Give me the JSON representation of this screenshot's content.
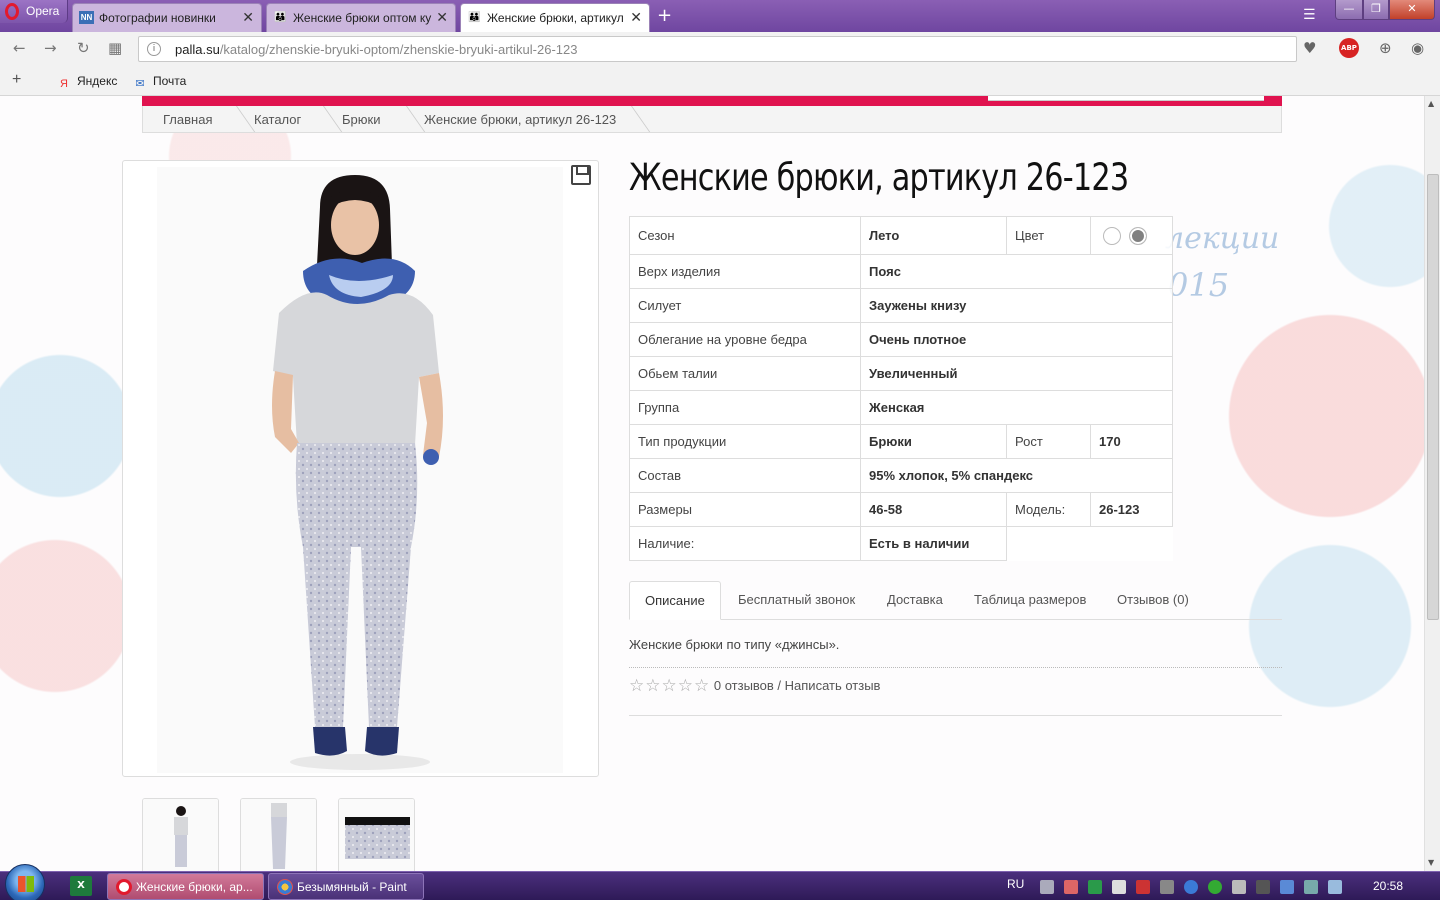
{
  "browser": {
    "menu_label": "Opera",
    "tabs": [
      {
        "favicon": "NN",
        "label": "Фотографии новинки",
        "active": false
      },
      {
        "favicon": "people-icon",
        "label": "Женские брюки оптом ку",
        "active": false
      },
      {
        "favicon": "people-icon",
        "label": "Женские брюки, артикул",
        "active": true
      }
    ],
    "url_host": "palla.su",
    "url_path": "/katalog/zhenskie-bryuki-optom/zhenskie-bryuki-artikul-26-123",
    "abp_label": "ABP",
    "bookmarks": [
      {
        "label": "Яндекс",
        "icon": "yandex-icon"
      },
      {
        "label": "Почта",
        "icon": "mail-icon"
      }
    ]
  },
  "page": {
    "breadcrumb": [
      "Главная",
      "Каталог",
      "Брюки",
      "Женские брюки, артикул 26-123"
    ],
    "promo_line1": "лекции",
    "promo_line2": "015",
    "title": "Женские брюки, артикул 26-123",
    "specs": [
      {
        "label": "Сезон",
        "value": "Лето",
        "label2": "Цвет",
        "value2": ""
      },
      {
        "label": "Верх изделия",
        "value": "Пояс"
      },
      {
        "label": "Силует",
        "value": "Заужены книзу"
      },
      {
        "label": "Облегание на уровне бедра",
        "value": "Очень плотное"
      },
      {
        "label": "Обьем талии",
        "value": "Увеличенный"
      },
      {
        "label": "Группа",
        "value": "Женская"
      },
      {
        "label": "Тип продукции",
        "value": "Брюки",
        "label2": "Рост",
        "value2": "170"
      },
      {
        "label": "Состав",
        "value": "95% хлопок, 5% спандекс"
      },
      {
        "label": "Размеры",
        "value": "46-58",
        "label2": "Модель:",
        "value2": "26-123"
      },
      {
        "label": "Наличие:",
        "value": "Есть в наличии"
      }
    ],
    "colors": [
      "#ffffff",
      "#808080"
    ],
    "tabs": [
      "Описание",
      "Бесплатный звонок",
      "Доставка",
      "Таблица размеров",
      "Отзывов (0)"
    ],
    "description": "Женские брюки по типу «джинсы».",
    "rating_stars": 0,
    "rating_text": "0 отзывов / Написать отзыв"
  },
  "taskbar": {
    "tasks": [
      {
        "label": "Женские брюки, ар...",
        "icon": "opera-icon"
      },
      {
        "label": "Безымянный - Paint",
        "icon": "paint-icon"
      }
    ],
    "language": "RU",
    "clock": "20:58"
  },
  "colors": {
    "accent": "#e0134f",
    "opera_frame": "#7b52a8",
    "taskbar": "#3a2268"
  }
}
